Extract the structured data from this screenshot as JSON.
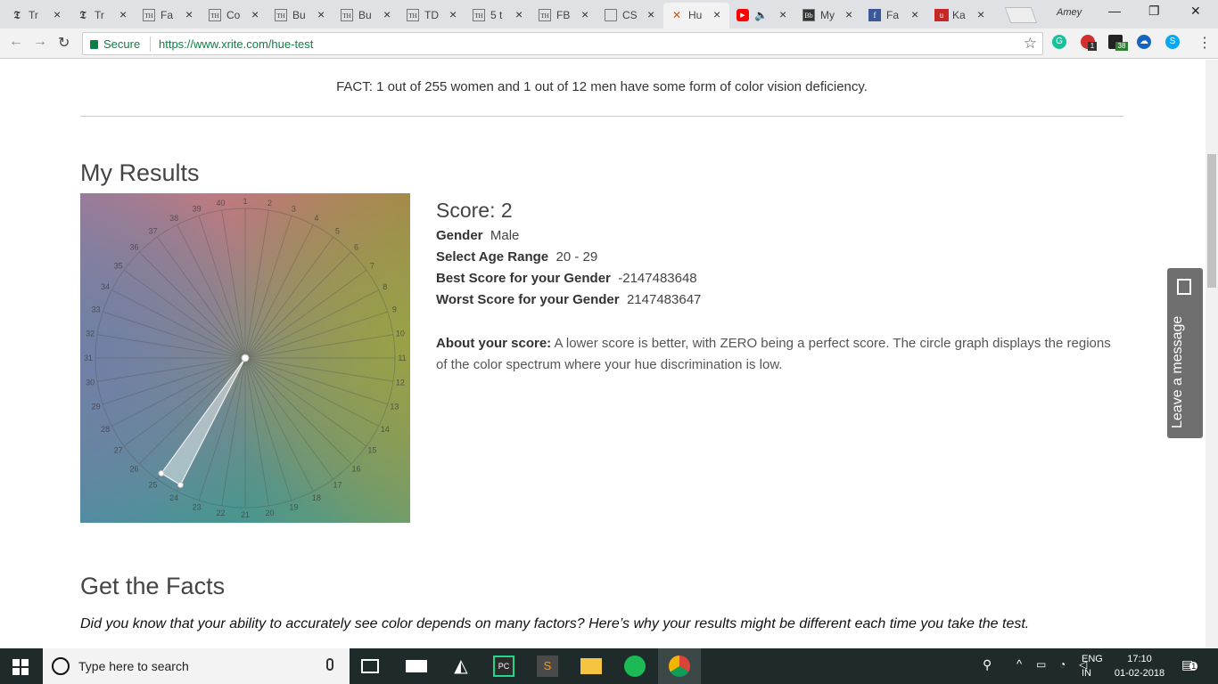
{
  "browser": {
    "tabs": [
      {
        "label": "Tr",
        "fav": "T"
      },
      {
        "label": "Tr",
        "fav": "T"
      },
      {
        "label": "Fa",
        "fav": "TH"
      },
      {
        "label": "Co",
        "fav": "TH"
      },
      {
        "label": "Bu",
        "fav": "TH"
      },
      {
        "label": "Bu",
        "fav": "TH"
      },
      {
        "label": "TD",
        "fav": "TH"
      },
      {
        "label": "5 t",
        "fav": "TH"
      },
      {
        "label": "FB",
        "fav": "TH"
      },
      {
        "label": "CS",
        "fav": "doc"
      },
      {
        "label": "Hu",
        "fav": "xrite"
      },
      {
        "label": "",
        "fav": "youtube"
      },
      {
        "label": "My",
        "fav": "Bb"
      },
      {
        "label": "Fa",
        "fav": "f"
      },
      {
        "label": "Ka",
        "fav": "usa"
      }
    ],
    "user": "Amey",
    "secure_label": "Secure",
    "url": "https://www.xrite.com/hue-test"
  },
  "page": {
    "fact": "FACT: 1 out of 255 women and 1 out of 12 men have some form of color vision deficiency.",
    "results_heading": "My Results",
    "score_label": "Score: 2",
    "gender_label": "Gender",
    "gender_value": "Male",
    "age_label": "Select Age Range",
    "age_value": "20 - 29",
    "best_label": "Best Score for your Gender",
    "best_value": "-2147483648",
    "worst_label": "Worst Score for your Gender",
    "worst_value": "2147483647",
    "about_label": "About your score:",
    "about_text": "A lower score is better, with ZERO being a perfect score. The circle graph displays the regions of the color spectrum where your hue discrimination is low.",
    "facts_heading": "Get the Facts",
    "facts_intro": "Did you know that your ability to accurately see color depends on many factors? Here’s why your results might be different each time you take the test.",
    "leave_message": "Leave a message"
  },
  "wheel": {
    "spokes": [
      "1",
      "2",
      "3",
      "4",
      "5",
      "6",
      "7",
      "8",
      "9",
      "10",
      "11",
      "12",
      "13",
      "14",
      "15",
      "16",
      "17",
      "18",
      "19",
      "20",
      "21",
      "22",
      "23",
      "24",
      "25",
      "26",
      "27",
      "28",
      "29",
      "30",
      "31",
      "32",
      "33",
      "34",
      "35",
      "36",
      "37",
      "38",
      "39",
      "40"
    ],
    "error_spokes": [
      24,
      25
    ]
  },
  "taskbar": {
    "search_placeholder": "Type here to search",
    "lang_top": "ENG",
    "lang_bottom": "IN",
    "time": "17:10",
    "date": "01-02-2018",
    "notif_count": "1"
  },
  "extensions": {
    "badge_1": "1",
    "badge_2": "38"
  }
}
